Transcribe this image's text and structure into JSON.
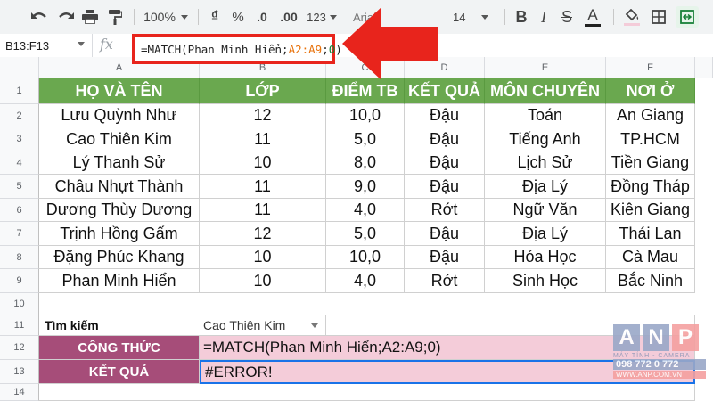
{
  "toolbar": {
    "zoom": "100%",
    "currency": "₫",
    "percent": "%",
    "dec_less": ".0",
    "dec_more": ".00",
    "format_more": "123",
    "font": "Arial",
    "font_size": "14",
    "bold": "B",
    "underline_a": "A"
  },
  "formula_bar": {
    "name_box": "B13:F13",
    "fx": "fx",
    "formula_prefix": "=MATCH(Phan Minh Hiển;",
    "formula_range": "A2:A9",
    "formula_sep": ";",
    "formula_arg": "0",
    "formula_close": ")"
  },
  "columns": [
    "A",
    "B",
    "C",
    "D",
    "E",
    "F"
  ],
  "rows": [
    "1",
    "2",
    "3",
    "4",
    "5",
    "6",
    "7",
    "8",
    "9",
    "10",
    "11",
    "12",
    "13",
    "14"
  ],
  "table": {
    "headers": [
      "HỌ VÀ TÊN",
      "LỚP",
      "ĐIỂM TB",
      "KẾT QUẢ",
      "MÔN CHUYÊN",
      "NƠI Ở"
    ],
    "data": [
      [
        "Lưu Quỳnh Như",
        "12",
        "10,0",
        "Đậu",
        "Toán",
        "An Giang"
      ],
      [
        "Cao Thiên Kim",
        "11",
        "5,0",
        "Đậu",
        "Tiếng Anh",
        "TP.HCM"
      ],
      [
        "Lý Thanh Sử",
        "10",
        "8,0",
        "Đậu",
        "Lịch Sử",
        "Tiền Giang"
      ],
      [
        "Châu Nhựt Thành",
        "11",
        "9,0",
        "Đậu",
        "Địa Lý",
        "Đồng Tháp"
      ],
      [
        "Dương Thùy Dương",
        "11",
        "4,0",
        "Rớt",
        "Ngữ Văn",
        "Kiên Giang"
      ],
      [
        "Trịnh Hồng Gấm",
        "12",
        "5,0",
        "Đậu",
        "Địa Lý",
        "Thái Lan"
      ],
      [
        "Đặng Phúc Khang",
        "10",
        "10,0",
        "Đậu",
        "Hóa Học",
        "Cà Mau"
      ],
      [
        "Phan Minh Hiển",
        "10",
        "4,0",
        "Rớt",
        "Sinh Học",
        "Bắc Ninh"
      ]
    ]
  },
  "search": {
    "label": "Tìm kiếm",
    "value": "Cao Thiên Kim"
  },
  "formula_row": {
    "label": "CÔNG THỨC",
    "value": "=MATCH(Phan Minh Hiển;A2:A9;0)"
  },
  "result_row": {
    "label": "KẾT QUẢ",
    "value": "#ERROR!"
  },
  "watermark": {
    "brand": "ANP",
    "line1": "MÁY TÍNH - CAMERA",
    "phone": "098 772 0 772",
    "site": "WWW.ANP.COM.VN"
  },
  "colors": {
    "header_green": "#6aa84f",
    "pink": "#f4ccd9",
    "maroon": "#a64d79",
    "arrow_red": "#e8241c",
    "orange_ref": "#e8710a",
    "selection_blue": "#1a73e8"
  }
}
